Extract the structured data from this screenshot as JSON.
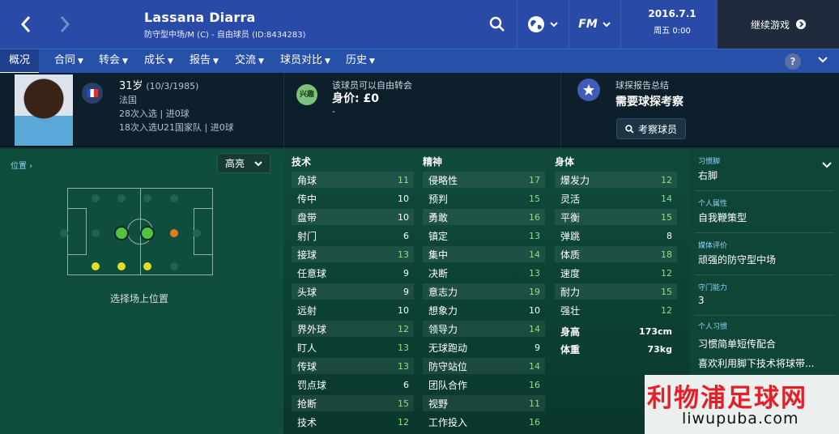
{
  "header": {
    "player_name": "Lassana Diarra",
    "player_sub": "防守型中场/M (C) - 自由球员 (ID:8434283)",
    "date": "2016.7.1",
    "weekday_time": "周五 0:00",
    "continue_label": "继续游戏",
    "fm_label": "FM"
  },
  "tabs": [
    {
      "label": "概况"
    },
    {
      "label": "合同"
    },
    {
      "label": "转会"
    },
    {
      "label": "成长"
    },
    {
      "label": "报告"
    },
    {
      "label": "交流"
    },
    {
      "label": "球员对比"
    },
    {
      "label": "历史"
    }
  ],
  "help_label": "?",
  "profile": {
    "age": "31岁",
    "dob": "(10/3/1985)",
    "nation": "法国",
    "caps": "28次入选 | 进0球",
    "u21_caps": "18次入选U21国家队 | 进0球"
  },
  "transfer": {
    "badge": "兴趣",
    "status": "该球员可以自由转会",
    "value": "身价: £0",
    "dash": "-"
  },
  "scout": {
    "title": "球探报告总结",
    "verdict": "需要球探考察",
    "button": "考察球员"
  },
  "position": {
    "link": "位置",
    "highlight": "高亮",
    "pick_label": "选择场上位置"
  },
  "columns": {
    "technical": "技术",
    "mental": "精神",
    "physical": "身体"
  },
  "technical": [
    {
      "name": "角球",
      "value": "11"
    },
    {
      "name": "传中",
      "value": "10"
    },
    {
      "name": "盘带",
      "value": "10"
    },
    {
      "name": "射门",
      "value": "6"
    },
    {
      "name": "接球",
      "value": "13"
    },
    {
      "name": "任意球",
      "value": "9"
    },
    {
      "name": "头球",
      "value": "9"
    },
    {
      "name": "远射",
      "value": "10"
    },
    {
      "name": "界外球",
      "value": "12"
    },
    {
      "name": "盯人",
      "value": "13"
    },
    {
      "name": "传球",
      "value": "13"
    },
    {
      "name": "罚点球",
      "value": "6"
    },
    {
      "name": "抢断",
      "value": "15"
    },
    {
      "name": "技术",
      "value": "12"
    }
  ],
  "mental": [
    {
      "name": "侵略性",
      "value": "17"
    },
    {
      "name": "预判",
      "value": "15"
    },
    {
      "name": "勇敢",
      "value": "16"
    },
    {
      "name": "镇定",
      "value": "13"
    },
    {
      "name": "集中",
      "value": "14"
    },
    {
      "name": "决断",
      "value": "13"
    },
    {
      "name": "意志力",
      "value": "19"
    },
    {
      "name": "想象力",
      "value": "10"
    },
    {
      "name": "领导力",
      "value": "14"
    },
    {
      "name": "无球跑动",
      "value": "9"
    },
    {
      "name": "防守站位",
      "value": "14"
    },
    {
      "name": "团队合作",
      "value": "16"
    },
    {
      "name": "视野",
      "value": "11"
    },
    {
      "name": "工作投入",
      "value": "16"
    }
  ],
  "physical": [
    {
      "name": "爆发力",
      "value": "12"
    },
    {
      "name": "灵活",
      "value": "14"
    },
    {
      "name": "平衡",
      "value": "15"
    },
    {
      "name": "弹跳",
      "value": "8"
    },
    {
      "name": "体质",
      "value": "18"
    },
    {
      "name": "速度",
      "value": "12"
    },
    {
      "name": "耐力",
      "value": "15"
    },
    {
      "name": "强壮",
      "value": "12"
    }
  ],
  "physical_extra": [
    {
      "name": "身高",
      "value": "173cm"
    },
    {
      "name": "体重",
      "value": "73kg"
    }
  ],
  "side": {
    "foot_label": "习惯脚",
    "foot": "右脚",
    "personality_label": "个人属性",
    "personality": "自我鞭策型",
    "media_label": "媒体评价",
    "media": "顽强的防守型中场",
    "gk_label": "守门能力",
    "gk": "3",
    "habits_label": "个人习惯",
    "habit1": "习惯简单短传配合",
    "habit2": "喜欢利用脚下技术将球带..."
  },
  "watermark": {
    "line1": "利物浦足球网",
    "line2": "liwupuba.com"
  },
  "colors": {
    "topbar": "#2a4aa8",
    "tabs": "#2750a8",
    "attr_green": "#8de07a",
    "attr_white": "#ffffff",
    "pos_green": "#53c23c",
    "pos_yellow": "#e3de2a",
    "pos_orange": "#e57a1f"
  }
}
